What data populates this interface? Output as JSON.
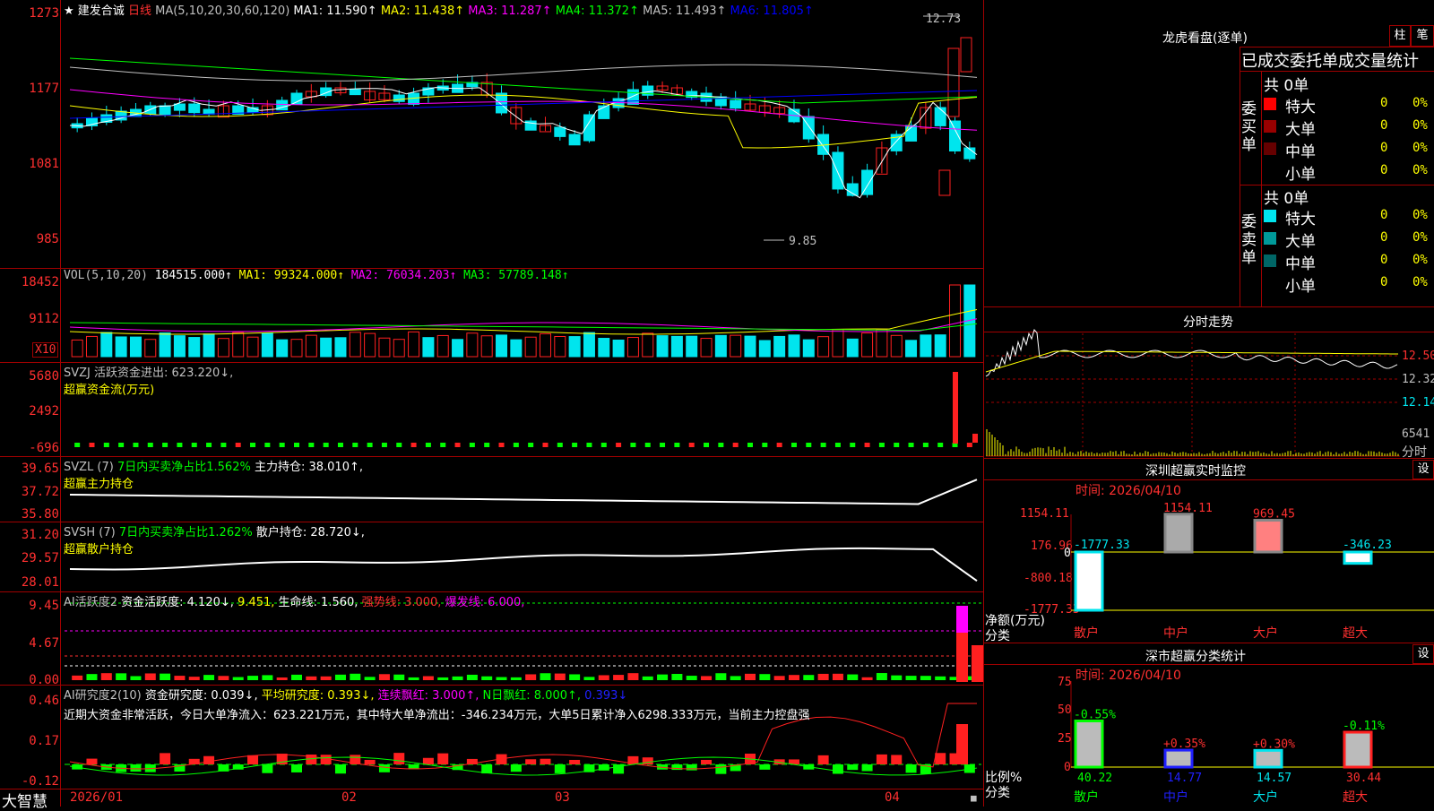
{
  "colors": {
    "up": "#ff2020",
    "down": "#00e5ee",
    "grid": "#a00000",
    "ma1": "#ffffff",
    "ma2": "#ffff00",
    "ma3": "#ff00ff",
    "ma4": "#00ff00",
    "ma5": "#c0c0c0",
    "ma6": "#0000ff"
  },
  "header": {
    "star": "★",
    "stock_name": "建发合诚",
    "period": "日线",
    "ma_params": "MA(5,10,20,30,60,120)",
    "ma1": "MA1: 11.590↑",
    "ma2": "MA2: 11.438↑",
    "ma3": "MA3: 11.287↑",
    "ma4": "MA4: 11.372↑",
    "ma5": "MA5: 11.493↑",
    "ma6": "MA6: 11.805↑",
    "high_label": "12.73",
    "low_label": "9.85"
  },
  "price_axis": [
    "1273",
    "1177",
    "1081",
    "985"
  ],
  "vol": {
    "params": "VOL(5,10,20)",
    "value": "184515.000↑",
    "ma1": "MA1: 99324.000↑",
    "ma2": "MA2: 76034.203↑",
    "ma3": "MA3: 57789.148↑",
    "axis": [
      "18452",
      "9112"
    ],
    "unit": "X10"
  },
  "svzj": {
    "line1": "SVZJ  活跃资金进出: 623.220↓,",
    "line2": "超赢资金流(万元)",
    "axis": [
      "5680",
      "2492",
      "-696"
    ]
  },
  "svzl": {
    "prefix": "SVZL (7)",
    "ratio": "7日内买卖净占比1.562%",
    "hold": "主力持仓: 38.010↑,",
    "line2": "超赢主力持仓",
    "axis": [
      "39.65",
      "37.72",
      "35.80"
    ]
  },
  "svsh": {
    "prefix": "SVSH (7)",
    "ratio": "7日内买卖净占比1.262%",
    "hold": "散户持仓: 28.720↓,",
    "line2": "超赢散户持仓",
    "axis": [
      "31.20",
      "29.57",
      "28.01"
    ]
  },
  "ai_active": {
    "prefix": "AI活跃度2",
    "deg": "资金活跃度: 4.120↓,",
    "v2": "9.451,",
    "life": "生命线: 1.560,",
    "strong": "强势线: 3.000,",
    "burst": "爆发线: 6.000,",
    "axis": [
      "9.45",
      "4.67",
      "0.00"
    ]
  },
  "ai_research": {
    "prefix": "AI研究度2(10)",
    "deg": "资金研究度: 0.039↓,",
    "avg": "平均研究度: 0.393↓,",
    "red": "连续飘红: 3.000↑,",
    "nred": "N日飘红: 8.000↑,",
    "v5": "0.393↓",
    "summary": "近期大资金非常活跃，今日大单净流入：623.221万元，其中特大单净流出：-346.234万元，大单5日累计净入6298.333万元，当前主力控盘强",
    "axis": [
      "0.46",
      "0.17",
      "-0.12"
    ]
  },
  "xaxis": {
    "labels": [
      "2026/01",
      "02",
      "03",
      "04"
    ],
    "logo": "大智慧"
  },
  "dragon": {
    "title": "龙虎看盘(逐单)",
    "btn1": "柱",
    "btn2": "笔",
    "subtitle": "已成交委托单成交量统计",
    "buy_label": "委买单",
    "sell_label": "委卖单",
    "buy_total": "共 0单",
    "sell_total": "共 0单",
    "buy_rows": [
      {
        "name": "特大",
        "n": "0",
        "p": "0%",
        "color": "#ff0000"
      },
      {
        "name": "大单",
        "n": "0",
        "p": "0%",
        "color": "#990000"
      },
      {
        "name": "中单",
        "n": "0",
        "p": "0%",
        "color": "#660000"
      },
      {
        "name": "小单",
        "n": "0",
        "p": "0%",
        "color": ""
      }
    ],
    "sell_rows": [
      {
        "name": "特大",
        "n": "0",
        "p": "0%",
        "color": "#00e5ee"
      },
      {
        "name": "大单",
        "n": "0",
        "p": "0%",
        "color": "#009999"
      },
      {
        "name": "中单",
        "n": "0",
        "p": "0%",
        "color": "#006666"
      },
      {
        "name": "小单",
        "n": "0",
        "p": "0%",
        "color": ""
      }
    ]
  },
  "intraday": {
    "title": "分时走势",
    "axis": [
      "12.50",
      "12.32",
      "12.14"
    ],
    "vol_label": "6541",
    "vol_unit": "分时"
  },
  "sz_monitor": {
    "title": "深圳超赢实时监控",
    "btn": "设",
    "time": "时间: 2026/04/10",
    "axis": [
      "1154.11",
      "176.96",
      "-800.18",
      "-1777.33"
    ],
    "zero": "0",
    "ylabel": "净额(万元)",
    "xlabel": "分类",
    "bars": [
      {
        "name": "散户",
        "value": -1777.33,
        "label": "-1777.33",
        "kind": "cyan"
      },
      {
        "name": "中户",
        "value": 1154.11,
        "label": "1154.11",
        "kind": "gray"
      },
      {
        "name": "大户",
        "value": 969.45,
        "label": "969.45",
        "kind": "red"
      },
      {
        "name": "超大",
        "value": -346.23,
        "label": "-346.23",
        "kind": "cyan"
      }
    ]
  },
  "sz_class": {
    "title": "深市超赢分类统计",
    "btn": "设",
    "time": "时间: 2026/04/10",
    "axis": [
      "75",
      "50",
      "25",
      "0"
    ],
    "ylabel": "比例%",
    "xlabel": "分类",
    "bars": [
      {
        "name": "散户",
        "value": 40.22,
        "label": "40.22",
        "delta": "-0.55%",
        "stripe": "#00ff00"
      },
      {
        "name": "中户",
        "value": 14.77,
        "label": "14.77",
        "delta": "+0.35%",
        "stripe": "#2020ff"
      },
      {
        "name": "大户",
        "value": 14.57,
        "label": "14.57",
        "delta": "+0.30%",
        "stripe": "#00e5ee"
      },
      {
        "name": "超大",
        "value": 30.44,
        "label": "30.44",
        "delta": "-0.11%",
        "stripe": "#ff2020"
      }
    ]
  }
}
